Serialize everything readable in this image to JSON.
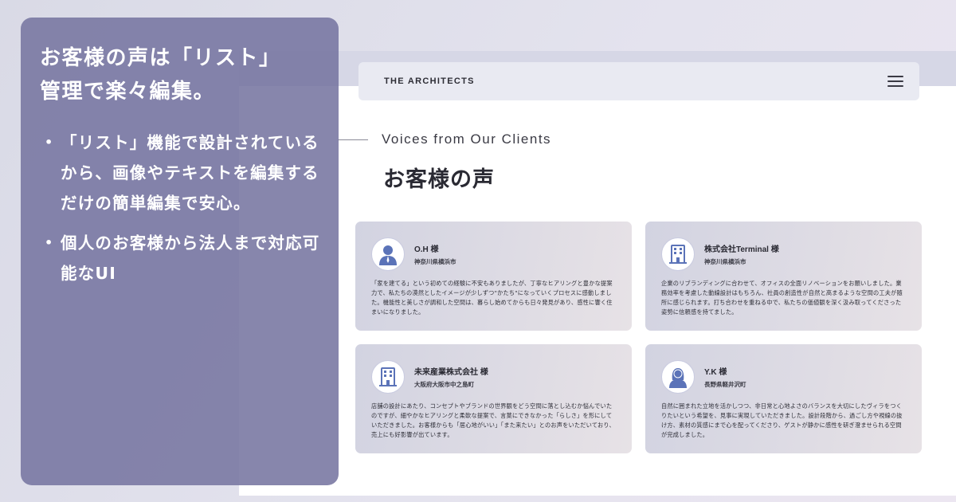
{
  "panel": {
    "title_line1": "お客様の声は「リスト」",
    "title_line2": "管理で楽々編集。",
    "bullets": [
      "「リスト」機能で設計されているから、画像やテキストを編集するだけの簡単編集で安心。",
      "個人のお客様から法人まで対応可能なUI"
    ]
  },
  "header": {
    "logo": "THE ARCHITECTS",
    "menu_icon": "hamburger-icon"
  },
  "section": {
    "en_title": "Voices from Our Clients",
    "jp_title": "お客様の声"
  },
  "cards": [
    {
      "icon": "person-male-icon",
      "name": "O.H 様",
      "place": "神奈川県横浜市",
      "comment": "「家を建てる」という初めての経験に不安もありましたが、丁寧なヒアリングと豊かな提案力で、私たちの漠然としたイメージが少しずつ\"かたち\"になっていくプロセスに感動しました。機能性と美しさが調和した空間は、暮らし始めてからも日々発見があり、感性に響く住まいになりました。"
    },
    {
      "icon": "building-icon",
      "name": "株式会社Terminal 様",
      "place": "神奈川県横浜市",
      "comment": "企業のリブランディングに合わせて、オフィスの全面リノベーションをお願いしました。業務効率を考慮した動線設計はもちろん、社員の創造性が自然と高まるような空間の工夫が随所に感じられます。打ち合わせを重ねる中で、私たちの価値観を深く汲み取ってくださった姿勢に信頼感を持てました。"
    },
    {
      "icon": "building-icon",
      "name": "未来産業株式会社 様",
      "place": "大阪府大阪市中之島町",
      "comment": "店舗の設計にあたり、コンセプトやブランドの世界観をどう空間に落とし込むか悩んでいたのですが、細やかなヒアリングと柔軟な提案で、言葉にできなかった「らしさ」を形にしていただきました。お客様からも「居心地がいい」「また来たい」とのお声をいただいており、売上にも好影響が出ています。"
    },
    {
      "icon": "person-female-icon",
      "name": "Y.K 様",
      "place": "長野県軽井沢町",
      "comment": "自然に囲まれた立地を活かしつつ、非日常と心地よさのバランスを大切にしたヴィラをつくりたいという希望を、見事に実現していただきました。設計段階から、過ごし方や視線の抜け方、素材の質感にまで心を配ってくださり、ゲストが静かに感性を研ぎ澄ませられる空間が完成しました。"
    }
  ],
  "colors": {
    "panel": "#7675a0",
    "accent_blue": "#5b73b8",
    "card_start": "#d2d3e1",
    "card_end": "#e7e2e6"
  }
}
